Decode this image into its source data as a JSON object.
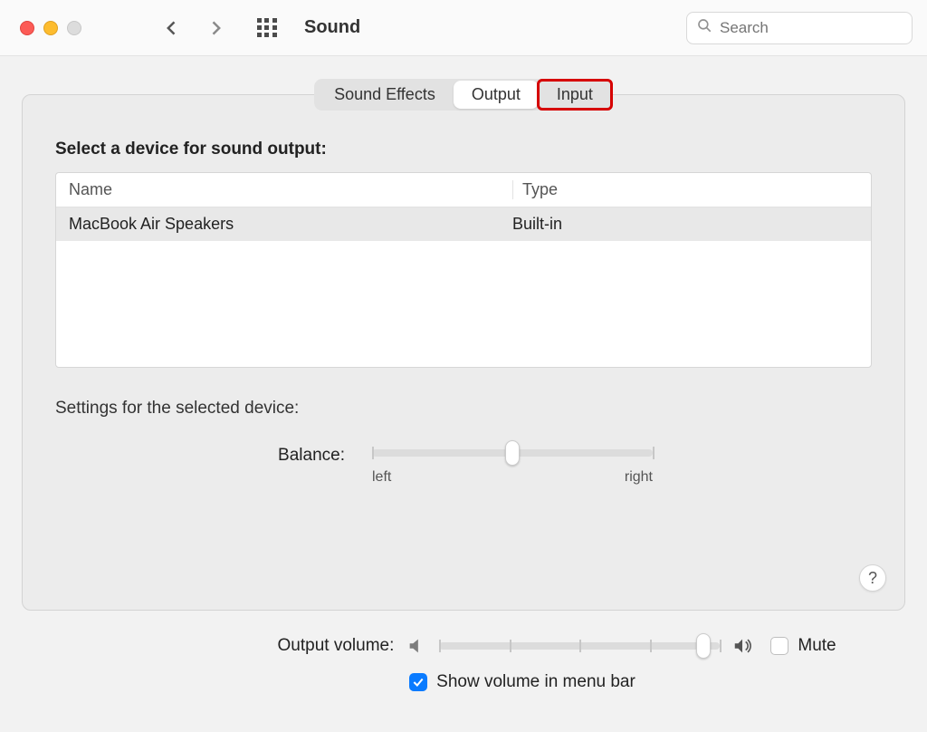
{
  "toolbar": {
    "title": "Sound",
    "search_placeholder": "Search"
  },
  "tabs": {
    "effects": "Sound Effects",
    "output": "Output",
    "input": "Input",
    "active": "output",
    "highlighted": "input"
  },
  "output": {
    "select_label": "Select a device for sound output:",
    "columns": {
      "name": "Name",
      "type": "Type"
    },
    "devices": [
      {
        "name": "MacBook Air Speakers",
        "type": "Built-in"
      }
    ],
    "settings_label": "Settings for the selected device:",
    "balance": {
      "label": "Balance:",
      "left": "left",
      "right": "right",
      "value_percent": 50
    }
  },
  "volume": {
    "label": "Output volume:",
    "value_percent": 94,
    "mute_label": "Mute",
    "mute_checked": false,
    "show_in_menu_bar_label": "Show volume in menu bar",
    "show_in_menu_bar_checked": true
  },
  "help_button": "?"
}
